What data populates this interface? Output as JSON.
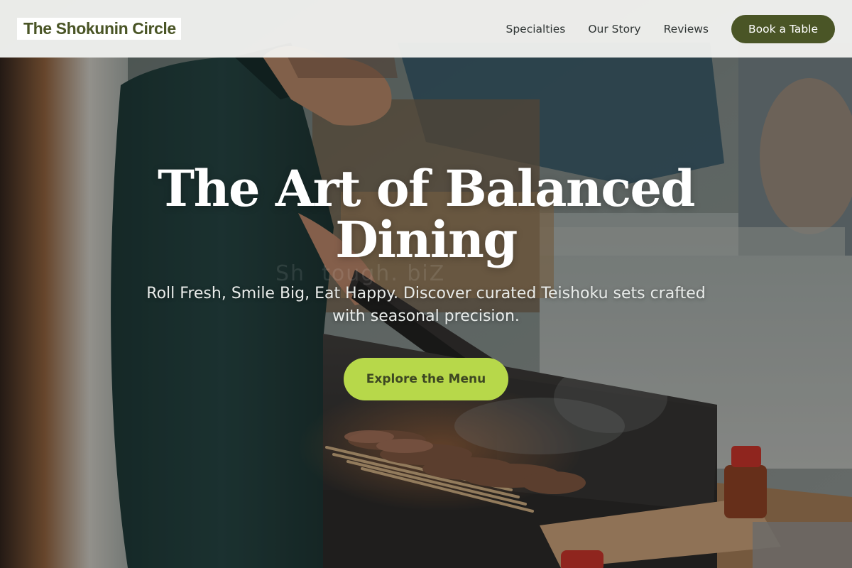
{
  "page": {
    "accent_color": "#4a5526",
    "cta_color": "#b7d84a"
  },
  "navbar": {
    "brand": "The Shokunin Circle",
    "links": [
      {
        "label": "Specialties"
      },
      {
        "label": "Our Story"
      },
      {
        "label": "Reviews"
      }
    ],
    "book_button": "Book a Table"
  },
  "hero": {
    "background_image": "chef-grilling-yakitori-skewers",
    "title": "The Art of Balanced Dining",
    "subtitle": "Roll Fresh, Smile Big, Eat Happy. Discover curated Teishoku sets crafted with seasonal precision.",
    "cta_button": "Explore the Menu"
  }
}
